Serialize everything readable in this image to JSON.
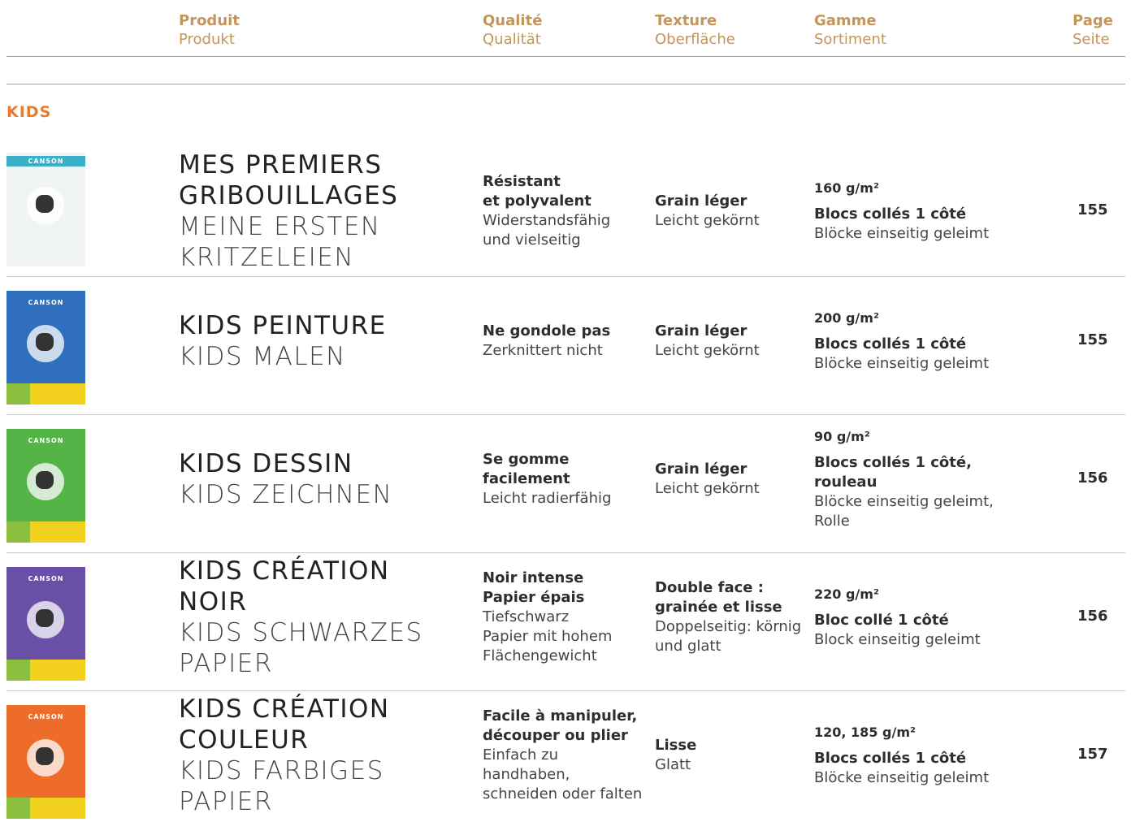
{
  "header": {
    "produit": {
      "fr": "Produit",
      "de": "Produkt"
    },
    "qualite": {
      "fr": "Qualité",
      "de": "Qualität"
    },
    "texture": {
      "fr": "Texture",
      "de": "Oberfläche"
    },
    "gamme": {
      "fr": "Gamme",
      "de": "Sortiment"
    },
    "page": {
      "fr": "Page",
      "de": "Seite"
    }
  },
  "section": "KIDS",
  "colors": {
    "accent": "#c4955a",
    "section": "#ea7a2c"
  },
  "rows": [
    {
      "title_fr": [
        "MES PREMIERS",
        "GRIBOUILLAGES"
      ],
      "title_de": [
        "MEINE ERSTEN",
        "KRITZELEIEN"
      ],
      "quality_fr": [
        "Résistant",
        "et polyvalent"
      ],
      "quality_de": [
        "Widerstandsfähig",
        "und vielseitig"
      ],
      "texture_fr": [
        "Grain léger"
      ],
      "texture_de": [
        "Leicht gekörnt"
      ],
      "weight": "160 g/m²",
      "range_fr": [
        "Blocs collés 1 côté"
      ],
      "range_de": [
        "Blöcke einseitig geleimt"
      ],
      "page": "155",
      "cover_color": "#f1f5f2",
      "logo_band": "#3bb0c9"
    },
    {
      "title_fr": [
        "KIDS PEINTURE"
      ],
      "title_de": [
        "KIDS MALEN"
      ],
      "quality_fr": [
        "Ne gondole pas"
      ],
      "quality_de": [
        "Zerknittert nicht"
      ],
      "texture_fr": [
        "Grain léger"
      ],
      "texture_de": [
        "Leicht gekörnt"
      ],
      "weight": "200 g/m²",
      "range_fr": [
        "Blocs collés 1 côté"
      ],
      "range_de": [
        "Blöcke einseitig geleimt"
      ],
      "page": "155",
      "cover_color": "#2f6fbd",
      "logo_band": "#2f6fbd"
    },
    {
      "title_fr": [
        "KIDS DESSIN"
      ],
      "title_de": [
        "KIDS ZEICHNEN"
      ],
      "quality_fr": [
        "Se gomme",
        "facilement"
      ],
      "quality_de": [
        "Leicht radierfähig"
      ],
      "texture_fr": [
        "Grain léger"
      ],
      "texture_de": [
        "Leicht gekörnt"
      ],
      "weight": "90 g/m²",
      "range_fr": [
        "Blocs collés 1 côté,",
        "rouleau"
      ],
      "range_de": [
        "Blöcke einseitig geleimt,",
        "Rolle"
      ],
      "page": "156",
      "cover_color": "#55b448",
      "logo_band": "#55b448"
    },
    {
      "title_fr": [
        "KIDS CRÉATION",
        "NOIR"
      ],
      "title_de": [
        "KIDS SCHWARZES",
        "PAPIER"
      ],
      "quality_fr": [
        "Noir intense",
        "Papier épais"
      ],
      "quality_de": [
        "Tiefschwarz",
        "Papier mit hohem",
        "Flächengewicht"
      ],
      "texture_fr": [
        "Double face :",
        "grainée et lisse"
      ],
      "texture_de": [
        "Doppelseitig: körnig",
        "und glatt"
      ],
      "weight": "220 g/m²",
      "range_fr": [
        "Bloc collé 1 côté"
      ],
      "range_de": [
        "Block einseitig geleimt"
      ],
      "page": "156",
      "cover_color": "#6a4fa6",
      "logo_band": "#6a4fa6"
    },
    {
      "title_fr": [
        "KIDS CRÉATION",
        "COULEUR"
      ],
      "title_de": [
        "KIDS FARBIGES",
        "PAPIER"
      ],
      "quality_fr": [
        "Facile à manipuler,",
        "découper ou plier"
      ],
      "quality_de": [
        "Einfach zu",
        "handhaben,",
        "schneiden oder falten"
      ],
      "texture_fr": [
        "Lisse"
      ],
      "texture_de": [
        "Glatt"
      ],
      "weight": "120, 185 g/m²",
      "range_fr": [
        "Blocs collés 1 côté"
      ],
      "range_de": [
        "Blöcke einseitig geleimt"
      ],
      "page": "157",
      "cover_color": "#ee6c2a",
      "logo_band": "#ee6c2a"
    }
  ]
}
